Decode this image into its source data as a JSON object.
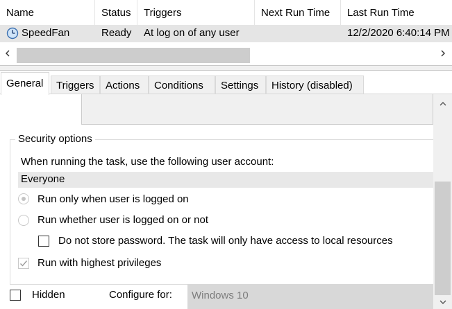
{
  "task_list": {
    "columns": [
      "Name",
      "Status",
      "Triggers",
      "Next Run Time",
      "Last Run Time"
    ],
    "rows": [
      {
        "name": "SpeedFan",
        "status": "Ready",
        "triggers": "At log on of any user",
        "next_run": "",
        "last_run": "12/2/2020 6:40:14 PM"
      }
    ],
    "scroll_left_icon": "chevron-left-icon",
    "scroll_right_icon": "chevron-right-icon"
  },
  "tabs": [
    {
      "label": "General",
      "active": true
    },
    {
      "label": "Triggers",
      "active": false
    },
    {
      "label": "Actions",
      "active": false
    },
    {
      "label": "Conditions",
      "active": false
    },
    {
      "label": "Settings",
      "active": false
    },
    {
      "label": "History (disabled)",
      "active": false
    }
  ],
  "general": {
    "security_group_title": "Security options",
    "account_prompt": "When running the task, use the following user account:",
    "account_value": "Everyone",
    "radio_logged_on": {
      "label": "Run only when user is logged on",
      "selected": true,
      "enabled": false
    },
    "radio_whether": {
      "label": "Run whether user is logged on or not",
      "selected": false,
      "enabled": false
    },
    "no_store_password": {
      "label": "Do not store password.  The task will only have access to local resources",
      "checked": false
    },
    "highest_privileges": {
      "label": "Run with highest privileges",
      "checked": true,
      "enabled": false
    },
    "hidden": {
      "label": "Hidden",
      "checked": false
    },
    "configure_for_label": "Configure for:",
    "configure_for_value": "Windows 10"
  },
  "colors": {
    "selected_row_bg": "#e5e5e5",
    "disabled_text": "#7d7d7d",
    "scroll_thumb": "#cdcdcd"
  }
}
